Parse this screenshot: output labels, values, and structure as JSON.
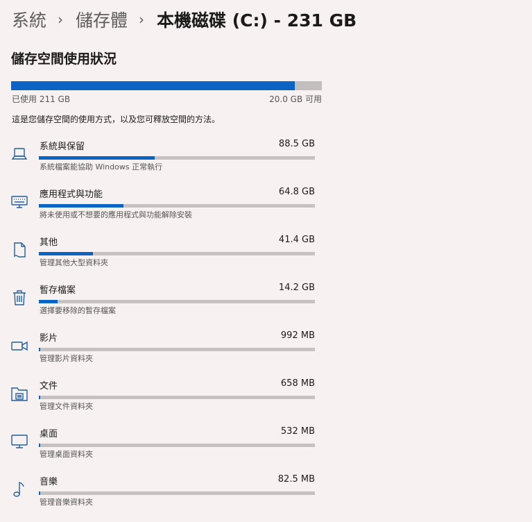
{
  "breadcrumb": {
    "items": [
      "系統",
      "儲存體"
    ],
    "separator": "›",
    "current": "本機磁碟 (C:) - 231 GB"
  },
  "storage": {
    "title": "儲存空間使用狀況",
    "used_label": "已使用 211 GB",
    "free_label": "20.0 GB 可用",
    "used_fraction": 0.9134,
    "description": "這是您儲存空間的使用方式，以及您可釋放空間的方法。",
    "bar_color": "#0b63c4",
    "track_color": "#c3bfbf",
    "categories": [
      {
        "name": "系統與保留",
        "size": "88.5 GB",
        "subtitle": "系統檔案能協助 Windows 正常執行",
        "fraction": 0.419,
        "icon": "laptop-icon"
      },
      {
        "name": "應用程式與功能",
        "size": "64.8 GB",
        "subtitle": "將未使用或不想要的應用程式與功能解除安裝",
        "fraction": 0.307,
        "icon": "keyboard-icon"
      },
      {
        "name": "其他",
        "size": "41.4 GB",
        "subtitle": "管理其他大型資料夾",
        "fraction": 0.196,
        "icon": "document-icon"
      },
      {
        "name": "暫存檔案",
        "size": "14.2 GB",
        "subtitle": "選擇要移除的暫存檔案",
        "fraction": 0.067,
        "icon": "trash-icon"
      },
      {
        "name": "影片",
        "size": "992 MB",
        "subtitle": "管理影片資料夾",
        "fraction": 0.005,
        "icon": "video-camera-icon"
      },
      {
        "name": "文件",
        "size": "658 MB",
        "subtitle": "管理文件資料夾",
        "fraction": 0.003,
        "icon": "folder-icon"
      },
      {
        "name": "桌面",
        "size": "532 MB",
        "subtitle": "管理桌面資料夾",
        "fraction": 0.0025,
        "icon": "monitor-icon"
      },
      {
        "name": "音樂",
        "size": "82.5 MB",
        "subtitle": "管理音樂資料夾",
        "fraction": 0.0004,
        "icon": "music-note-icon"
      }
    ]
  }
}
